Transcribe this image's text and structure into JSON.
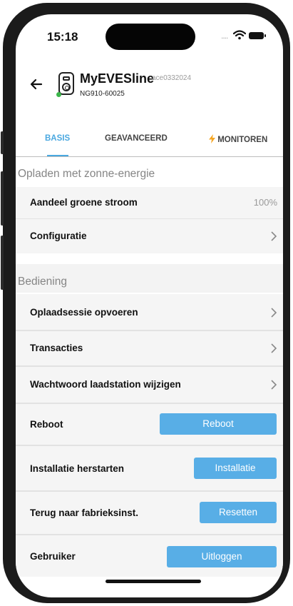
{
  "status_bar": {
    "time": "15:18",
    "signal_dots": "....",
    "wifi_icon": "wifi-icon",
    "battery_icon": "battery-icon"
  },
  "header": {
    "back_icon": "arrow-left-icon",
    "device_icon": "charger-icon",
    "device_name": "MyEVESline",
    "device_id": "ace0332024",
    "device_serial": "NG910-60025",
    "status_color": "#3bb54a"
  },
  "tabs": [
    {
      "label": "BASIS",
      "active": true
    },
    {
      "label": "GEAVANCEERD",
      "active": false
    },
    {
      "label": "MONITOREN",
      "active": false,
      "icon": "lightning-icon"
    }
  ],
  "solar": {
    "title": "Opladen met zonne-energie",
    "rows": [
      {
        "label": "Aandeel groene stroom",
        "value": "100%"
      },
      {
        "label": "Configuratie",
        "chevron": true
      }
    ]
  },
  "control": {
    "title": "Bediening",
    "rows": [
      {
        "label": "Oplaadsessie opvoeren",
        "chevron": true
      },
      {
        "label": "Transacties",
        "chevron": true
      },
      {
        "label": "Wachtwoord laadstation wijzigen",
        "chevron": true
      },
      {
        "label": "Reboot",
        "button": "Reboot"
      },
      {
        "label": "Installatie herstarten",
        "button": "Installatie"
      },
      {
        "label": "Terug naar fabrieksinst.",
        "button": "Resetten"
      },
      {
        "label": "Gebruiker",
        "button": "Uitloggen"
      }
    ]
  },
  "colors": {
    "accent": "#4aa8e0",
    "button": "#58aee6",
    "row_bg": "#f5f5f5",
    "lightning": "#f5a623"
  }
}
